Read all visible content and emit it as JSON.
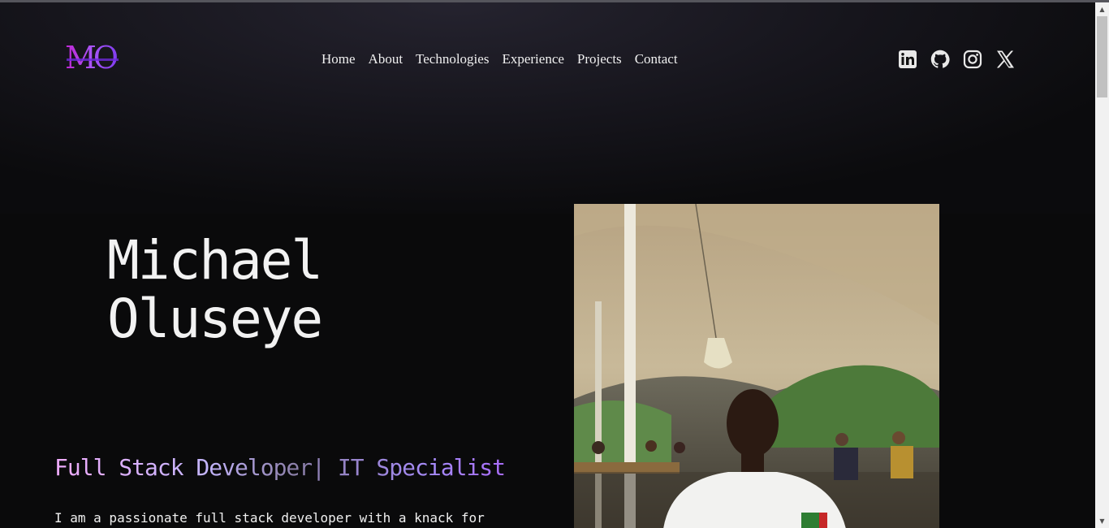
{
  "logo": {
    "text": "MO"
  },
  "nav": {
    "items": [
      "Home",
      "About",
      "Technologies",
      "Experience",
      "Projects",
      "Contact"
    ]
  },
  "socials": {
    "icons": [
      "linkedin-icon",
      "github-icon",
      "instagram-icon",
      "x-icon"
    ]
  },
  "hero": {
    "name_first": "Michael",
    "name_last": "Oluseye",
    "role": "Full Stack Developer| IT Specialist",
    "bio": "I am a passionate full stack developer with a knack for"
  },
  "colors": {
    "background": "#0a0a0b",
    "accent_pink": "#f0abfc",
    "accent_purple": "#a855f7"
  }
}
